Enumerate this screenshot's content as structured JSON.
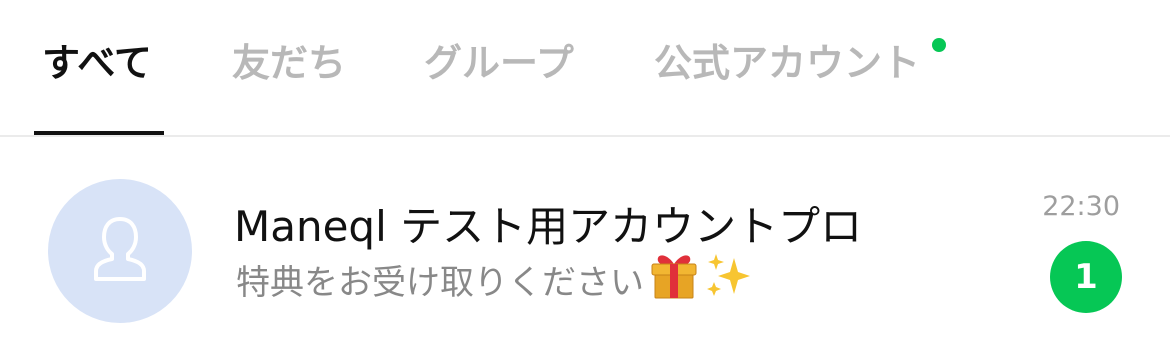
{
  "colors": {
    "accent_green": "#06C755",
    "active_text": "#111111",
    "inactive_text": "#B8B8B8",
    "avatar_bg": "#D8E3F7"
  },
  "tabs": [
    {
      "label": "すべて",
      "active": true
    },
    {
      "label": "友だち",
      "active": false
    },
    {
      "label": "グループ",
      "active": false
    },
    {
      "label": "公式アカウント",
      "active": false,
      "has_notification_dot": true
    }
  ],
  "chats": [
    {
      "name": "Maneql テスト用アカウントプロ",
      "preview": "特典をお受け取りください",
      "preview_emojis": [
        "gift-icon",
        "sparkles-icon"
      ],
      "time": "22:30",
      "unread_count": "1",
      "avatar_icon": "default-user-icon"
    }
  ]
}
